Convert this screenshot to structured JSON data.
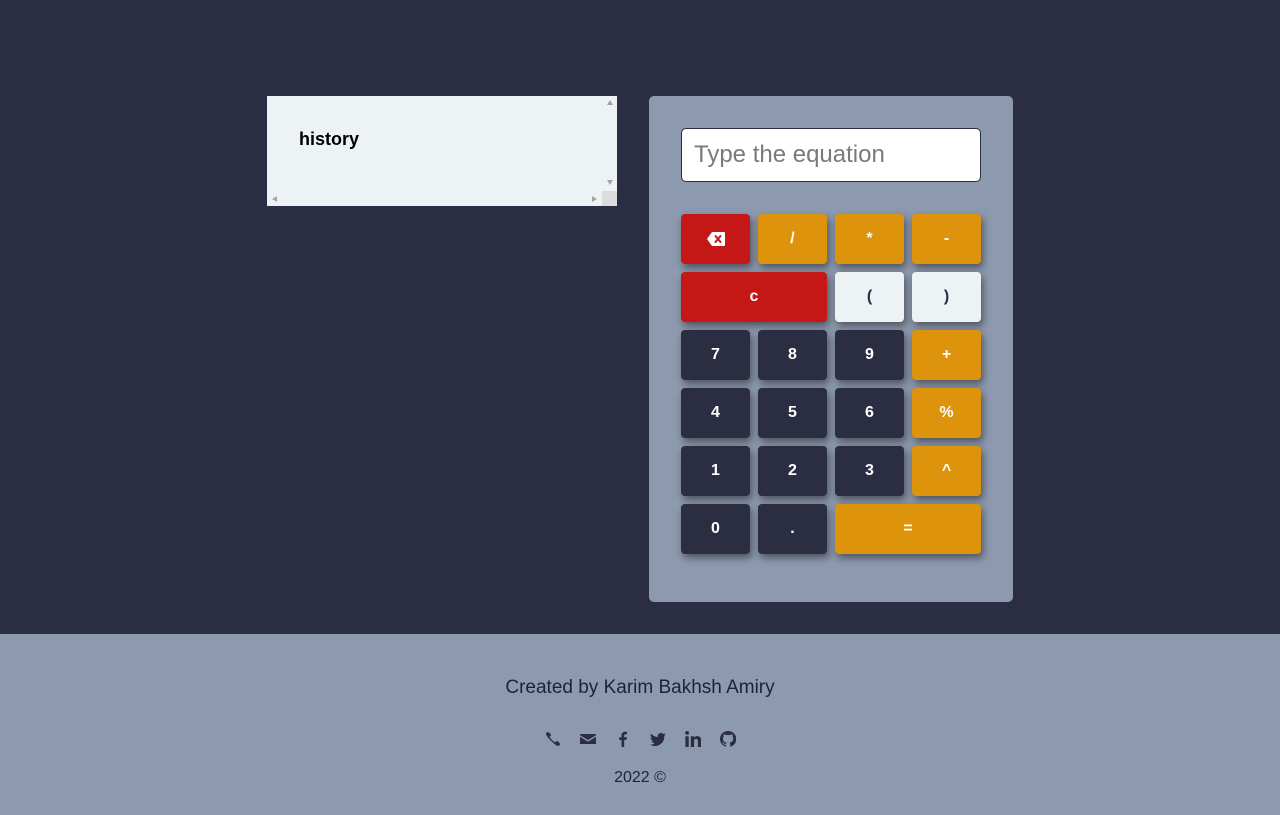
{
  "history": {
    "title": "history"
  },
  "calculator": {
    "equation_placeholder": "Type the equation",
    "equation_value": "",
    "buttons": {
      "backspace": "backspace-icon",
      "divide": "/",
      "multiply": "*",
      "minus": "-",
      "clear": "c",
      "open_paren": "(",
      "close_paren": ")",
      "seven": "7",
      "eight": "8",
      "nine": "9",
      "plus": "+",
      "four": "4",
      "five": "5",
      "six": "6",
      "percent": "%",
      "one": "1",
      "two": "2",
      "three": "3",
      "power": "^",
      "zero": "0",
      "dot": ".",
      "equals": "="
    }
  },
  "footer": {
    "credit": "Created by Karim Bakhsh Amiry",
    "socials": [
      "phone-icon",
      "envelope-icon",
      "facebook-icon",
      "twitter-icon",
      "linkedin-icon",
      "github-icon"
    ],
    "copyright": "2022 ©"
  },
  "colors": {
    "background": "#2b2d42",
    "panel": "#8d99ae",
    "light": "#edf2f4",
    "red": "#c61717",
    "orange": "#dd930c"
  }
}
